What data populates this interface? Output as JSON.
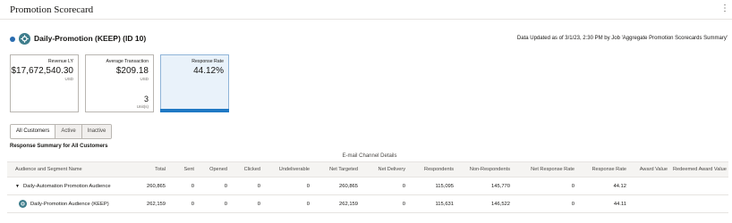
{
  "app": {
    "title": "Promotion Scorecard",
    "menu_icon": "kebab-menu-icon"
  },
  "header": {
    "promotion_title": "Daily-Promotion (KEEP) (ID 10)",
    "updated_text": "Data Updated as of 3/1/23, 2:30 PM by Job 'Aggregate Promotion Scorecards Summary'",
    "status_color": "#2a6cb0",
    "icon": "promotion-icon"
  },
  "cards": {
    "revenue": {
      "label": "Revenue LY",
      "value": "$17,672,540.30",
      "unit": "USD"
    },
    "avg_transaction": {
      "label": "Average Transaction",
      "value": "$209.18",
      "unit": "USD",
      "count": "3",
      "count_unit": "Unit(s)"
    },
    "response_rate": {
      "label": "Response Rate",
      "value": "44.12%",
      "progress": 44.12,
      "accent": "#1f79c4"
    }
  },
  "filters": {
    "all": "All Customers",
    "active": "Active",
    "inactive": "Inactive",
    "selected": "All Customers"
  },
  "section_title": "Response Summary for All Customers",
  "group_header": "E-mail Channel Details",
  "table": {
    "columns": [
      "Audience and Segment Name",
      "Total",
      "Sent",
      "Opened",
      "Clicked",
      "Undeliverable",
      "Net Targeted",
      "Net Delivery",
      "Respondents",
      "Non-Respondents",
      "Net Response Rate",
      "Response Rate",
      "Award Value",
      "Redeemed Award Value"
    ],
    "rows": [
      {
        "name": "Daily-Automation Promotion Audience",
        "cells": [
          "260,865",
          "0",
          "0",
          "0",
          "0",
          "260,865",
          "0",
          "115,095",
          "145,770",
          "0",
          "44.12",
          "",
          ""
        ]
      },
      {
        "name": "Daily-Promotion Audience (KEEP)",
        "cells": [
          "262,159",
          "0",
          "0",
          "0",
          "0",
          "262,159",
          "0",
          "115,631",
          "146,522",
          "0",
          "44.11",
          "",
          ""
        ]
      }
    ]
  }
}
